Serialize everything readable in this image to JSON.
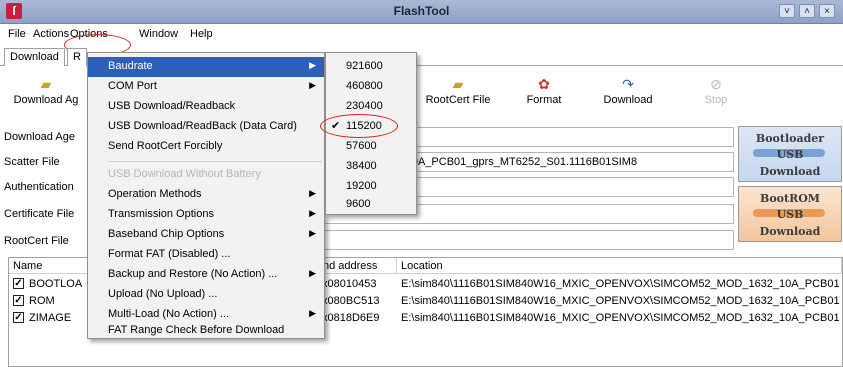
{
  "window": {
    "title": "FlashTool",
    "icon_glyph": "ſ",
    "buttons": [
      "˅",
      "˄",
      "×"
    ]
  },
  "menubar": {
    "items": [
      "File",
      "Actions",
      "Options",
      "Window",
      "Help"
    ]
  },
  "tabs": {
    "items": [
      "Download",
      "R"
    ]
  },
  "toolbar": {
    "download_agent": "Download Ag",
    "rootcert_file": "RootCert File",
    "format": "Format",
    "download": "Download",
    "stop": "Stop"
  },
  "fields": {
    "download_agent_label": "Download Age",
    "scatter_label": "Scatter File",
    "scatter_value": "52_MOD_1632_10A_PCB01_gprs_MT6252_S01.1116B01SIM8",
    "authentication_label": "Authentication",
    "certificate_label": "Certificate File",
    "rootcert_label": "RootCert File"
  },
  "side_buttons": {
    "bootloader": {
      "line1": "Bootloader",
      "line2": "USB",
      "line3": "Download"
    },
    "bootrom": {
      "line1": "BootROM",
      "line2": "USB",
      "line3": "Download"
    }
  },
  "table": {
    "headers": {
      "name": "Name",
      "end_address": "nd address",
      "location": "Location"
    },
    "rows": [
      {
        "name": "BOOTLOA",
        "end": "x08010453",
        "location": "E:\\sim840\\1116B01SIM840W16_MXIC_OPENVOX\\SIMCOM52_MOD_1632_10A_PCB01"
      },
      {
        "name": "ROM",
        "end": "x080BC513",
        "location": "E:\\sim840\\1116B01SIM840W16_MXIC_OPENVOX\\SIMCOM52_MOD_1632_10A_PCB01"
      },
      {
        "name": "ZIMAGE",
        "end": "x0818D6E9",
        "location": "E:\\sim840\\1116B01SIM840W16_MXIC_OPENVOX\\SIMCOM52_MOD_1632_10A_PCB01"
      }
    ]
  },
  "options_menu": {
    "items": [
      "Baudrate",
      "COM Port",
      "USB Download/Readback",
      "USB Download/ReadBack (Data Card)",
      "Send RootCert Forcibly",
      "USB Download Without Battery",
      "Operation Methods",
      "Transmission Options",
      "Baseband Chip Options",
      "Format FAT (Disabled) ...",
      "Backup and Restore (No Action) ...",
      "Upload (No Upload) ...",
      "Multi-Load (No Action) ...",
      "FAT Range Check Before Download"
    ]
  },
  "baudrate_menu": {
    "items": [
      "921600",
      "460800",
      "230400",
      "115200",
      "57600",
      "38400",
      "19200",
      "9600"
    ],
    "selected": "115200",
    "check_glyph": "✔"
  },
  "colors": {
    "highlight": "#2e5fb8",
    "annotation": "#dd2222"
  }
}
